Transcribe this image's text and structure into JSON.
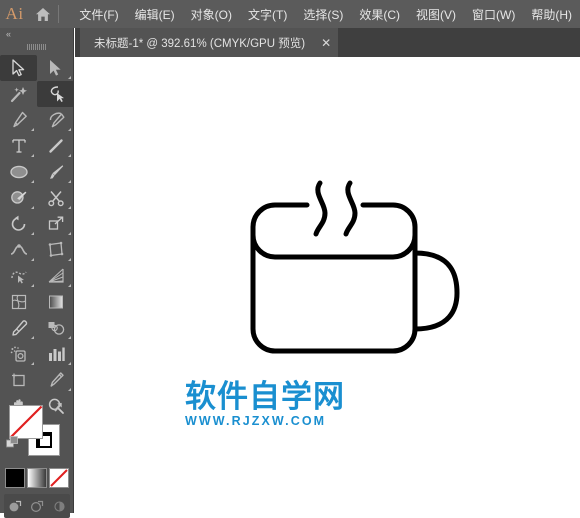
{
  "app": {
    "name": "Adobe Illustrator",
    "logo_text": "Ai",
    "logo_color": "#d49a6a",
    "home_icon": "home-icon"
  },
  "menubar": {
    "background": "#5b5b5b",
    "items": [
      {
        "label": "文件(F)"
      },
      {
        "label": "编辑(E)"
      },
      {
        "label": "对象(O)"
      },
      {
        "label": "文字(T)"
      },
      {
        "label": "选择(S)"
      },
      {
        "label": "效果(C)"
      },
      {
        "label": "视图(V)"
      },
      {
        "label": "窗口(W)"
      },
      {
        "label": "帮助(H)"
      }
    ]
  },
  "tabbar": {
    "background": "#3f3f3f",
    "tabs": [
      {
        "title": "未标题-1* @ 392.61% (CMYK/GPU 预览)",
        "close_label": "✕",
        "active": true
      }
    ]
  },
  "canvas": {
    "background": "#ffffff",
    "zoom_level": "392.61%",
    "color_mode": "CMYK",
    "preview_mode": "GPU 预览",
    "artwork": {
      "name": "coffee-cup-outline",
      "stroke_color": "#000000",
      "fill": "none",
      "parts": [
        "cup-body",
        "cup-rim",
        "cup-handle",
        "steam-left",
        "steam-right"
      ]
    }
  },
  "watermark": {
    "chinese": "软件自学网",
    "url": "WWW.RJZXW.COM",
    "color": "#1a8fd0"
  },
  "toolpanel": {
    "background": "#535353",
    "collapse_label": "«",
    "tools": [
      [
        {
          "name": "selection-tool",
          "selected": true,
          "has_flyout": false
        },
        {
          "name": "direct-selection-tool",
          "selected": false,
          "has_flyout": true
        }
      ],
      [
        {
          "name": "magic-wand-tool",
          "selected": false,
          "has_flyout": false
        },
        {
          "name": "curvature-tool",
          "selected": true,
          "has_flyout": false
        }
      ],
      [
        {
          "name": "pen-tool",
          "selected": false,
          "has_flyout": true
        },
        {
          "name": "add-anchor-point-tool",
          "selected": false,
          "has_flyout": true
        }
      ],
      [
        {
          "name": "type-tool",
          "selected": false,
          "has_flyout": true
        },
        {
          "name": "line-segment-tool",
          "selected": false,
          "has_flyout": true
        }
      ],
      [
        {
          "name": "ellipse-tool",
          "selected": false,
          "has_flyout": true
        },
        {
          "name": "paintbrush-tool",
          "selected": false,
          "has_flyout": true
        }
      ],
      [
        {
          "name": "shaper-tool",
          "selected": false,
          "has_flyout": true
        },
        {
          "name": "scissors-tool",
          "selected": false,
          "has_flyout": true
        }
      ],
      [
        {
          "name": "rotate-tool",
          "selected": false,
          "has_flyout": true
        },
        {
          "name": "scale-tool",
          "selected": false,
          "has_flyout": true
        }
      ],
      [
        {
          "name": "width-tool",
          "selected": false,
          "has_flyout": true
        },
        {
          "name": "free-transform-tool",
          "selected": false,
          "has_flyout": true
        }
      ],
      [
        {
          "name": "shape-builder-tool",
          "selected": false,
          "has_flyout": true
        },
        {
          "name": "perspective-grid-tool",
          "selected": false,
          "has_flyout": true
        }
      ],
      [
        {
          "name": "mesh-tool",
          "selected": false,
          "has_flyout": false
        },
        {
          "name": "gradient-tool",
          "selected": false,
          "has_flyout": false
        }
      ],
      [
        {
          "name": "eyedropper-tool",
          "selected": false,
          "has_flyout": true
        },
        {
          "name": "blend-tool",
          "selected": false,
          "has_flyout": true
        }
      ],
      [
        {
          "name": "symbol-sprayer-tool",
          "selected": false,
          "has_flyout": true
        },
        {
          "name": "column-graph-tool",
          "selected": false,
          "has_flyout": true
        }
      ],
      [
        {
          "name": "artboard-tool",
          "selected": false,
          "has_flyout": false
        },
        {
          "name": "slice-tool",
          "selected": false,
          "has_flyout": true
        }
      ],
      [
        {
          "name": "hand-tool",
          "selected": false,
          "has_flyout": true
        },
        {
          "name": "zoom-tool",
          "selected": false,
          "has_flyout": false
        }
      ]
    ],
    "fill_stroke": {
      "fill_name": "fill-swatch",
      "fill_value": "none",
      "stroke_name": "stroke-swatch",
      "stroke_value": "#000000",
      "swap_icon": "swap-fill-stroke-icon",
      "default_icon": "default-fill-stroke-icon"
    },
    "color_modes": [
      {
        "name": "color-button",
        "label": "color",
        "value": "#000000"
      },
      {
        "name": "gradient-button",
        "label": "gradient",
        "value": "gradient"
      },
      {
        "name": "none-button",
        "label": "none",
        "value": "none"
      }
    ],
    "screen_modes": [
      {
        "name": "screen-mode-normal"
      },
      {
        "name": "screen-mode-full-menu"
      },
      {
        "name": "screen-mode-full"
      }
    ]
  }
}
